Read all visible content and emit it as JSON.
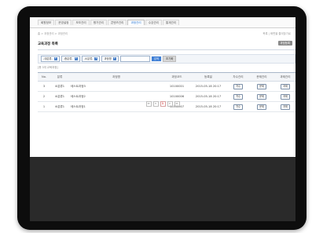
{
  "nav": {
    "tabs": [
      "회원정보",
      "운영설정",
      "보조관리",
      "평가관리",
      "콘텐츠관리",
      "과정관리",
      "수강관리",
      "통계관리"
    ],
    "active_tab": "과정관리"
  },
  "breadcrumb": "홈 > 과정관리 > 과정관리",
  "top_right_text": "목록 | 화면을 즐겨찾기로",
  "page": {
    "title": "교육과정 목록",
    "title_button": "과정등록"
  },
  "filters": {
    "selects": [
      "-대분류-",
      "-중분류-",
      "-소분류-",
      "과정명"
    ],
    "search_placeholder": "",
    "search_button": "검색",
    "reset_button": "초기화"
  },
  "total_text": "[총 3개 교육과정]",
  "table": {
    "headers": [
      "No.",
      "분류",
      "과정명",
      "과정코드",
      "등록일",
      "차수관리",
      "문제관리",
      "과제관리"
    ],
    "rows": [
      {
        "no": "3",
        "category": "소분류1",
        "name": "테스트과정3",
        "code": "10100001",
        "date": "2015-05-18 20:17",
        "b1": "차수",
        "b2": "문제",
        "b3": "과제"
      },
      {
        "no": "2",
        "category": "소분류1",
        "name": "테스트과정2",
        "code": "10100006",
        "date": "2015-05-18 20:17",
        "b1": "차수",
        "b2": "문제",
        "b3": "과제"
      },
      {
        "no": "1",
        "category": "소분류1",
        "name": "테스트과정1",
        "code": "10100007",
        "date": "2015-05-18 20:17",
        "b1": "차수",
        "b2": "문제",
        "b3": "과제"
      }
    ]
  },
  "pagination": [
    "≪",
    "<",
    "1",
    ">",
    "≫"
  ],
  "pagination_current": "1"
}
